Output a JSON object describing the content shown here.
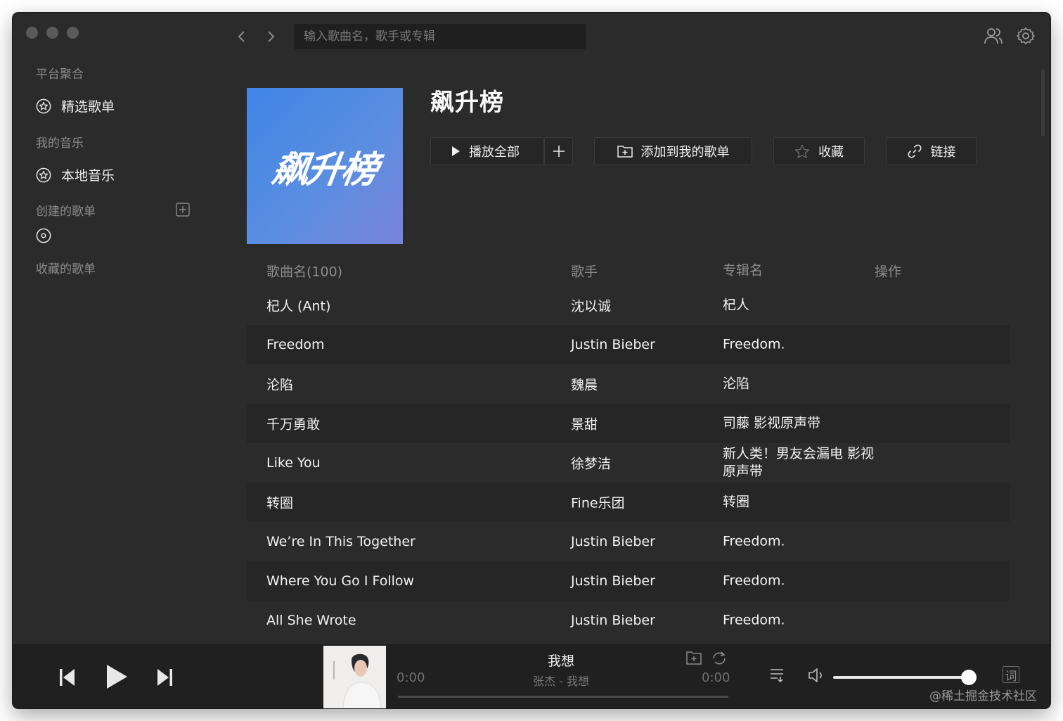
{
  "search": {
    "placeholder": "输入歌曲名，歌手或专辑"
  },
  "sidebar": {
    "section_platform": "平台聚合",
    "item_featured": "精选歌单",
    "section_my_music": "我的音乐",
    "item_local": "本地音乐",
    "section_created": "创建的歌单",
    "section_collected": "收藏的歌单"
  },
  "playlist": {
    "cover_text": "飙升榜",
    "title": "飙升榜",
    "play_all": "播放全部",
    "add_to_playlist": "添加到我的歌单",
    "favorite": "收藏",
    "link": "链接"
  },
  "table": {
    "headers": [
      "歌曲名(100)",
      "歌手",
      "专辑名",
      "操作"
    ],
    "rows": [
      {
        "song": "杞人 (Ant)",
        "artist": "沈以诚",
        "album": "杞人"
      },
      {
        "song": "Freedom",
        "artist": "Justin Bieber",
        "album": "Freedom."
      },
      {
        "song": "沦陷",
        "artist": "魏晨",
        "album": "沦陷"
      },
      {
        "song": "千万勇敢",
        "artist": "景甜",
        "album": "司藤 影视原声带"
      },
      {
        "song": "Like You",
        "artist": "徐梦洁",
        "album": "新人类！男友会漏电 影视原声带"
      },
      {
        "song": "转圈",
        "artist": "Fine乐团",
        "album": "转圈"
      },
      {
        "song": "We’re In This Together",
        "artist": "Justin Bieber",
        "album": "Freedom."
      },
      {
        "song": "Where You Go I Follow",
        "artist": "Justin Bieber",
        "album": "Freedom."
      },
      {
        "song": "All She Wrote",
        "artist": "Justin Bieber",
        "album": "Freedom."
      }
    ]
  },
  "player": {
    "song": "我想",
    "subtitle": "张杰 - 我想",
    "time_current": "0:00",
    "time_total": "0:00",
    "lyrics_label": "词",
    "progress": 0,
    "volume": 1.0
  },
  "watermark": "@稀土掘金技术社区",
  "colors": {
    "window_bg": "#2b2b2b",
    "player_bg": "#202020",
    "cover_gradient_start": "#3f85e6",
    "cover_gradient_end": "#7a83dc"
  },
  "icons": [
    "back-icon",
    "forward-icon",
    "users-icon",
    "settings-icon",
    "star-circle-icon",
    "disc-icon",
    "plus-square-icon",
    "play-icon",
    "plus-icon",
    "folder-add-icon",
    "star-icon",
    "link-icon",
    "prev-icon",
    "next-icon",
    "repeat-icon",
    "playlist-icon",
    "volume-icon"
  ]
}
